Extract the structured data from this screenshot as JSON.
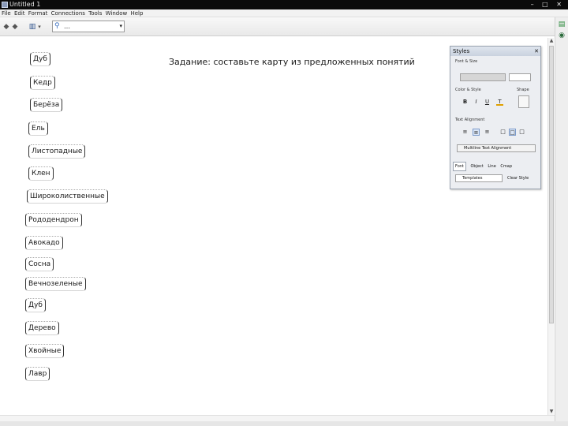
{
  "window": {
    "title": "Untitled 1",
    "controls": "– □ ✕"
  },
  "menu": [
    "File",
    "Edit",
    "Format",
    "Connections",
    "Tools",
    "Window",
    "Help"
  ],
  "toolbar": {
    "back_icon": "◆",
    "forward_icon": "◆",
    "page_icon": "▥",
    "page_dropdown": "▾",
    "zoom_value": "…",
    "zoom_arrow": "▾"
  },
  "canvas": {
    "task": "Задание: составьте карту из предложенных понятий",
    "concepts": [
      "Дуб",
      "Кедр",
      "Берёза",
      "Ель",
      "Листопадные",
      "Клен",
      "Широколиственные",
      "Рододендрон",
      "Авокадо",
      "Сосна",
      "Вечнозеленые",
      "Дуб",
      "Дерево",
      "Хвойные",
      "Лавр"
    ]
  },
  "styles_panel": {
    "title": "Styles",
    "font_label": "Font & Size",
    "color_label": "Color & Style",
    "shape_label": "Shape",
    "bold": "B",
    "italic": "I",
    "underline": "U",
    "font_color": "T",
    "align_label": "Text Alignment",
    "align_left": "≡",
    "align_center": "≡",
    "align_right": "≡",
    "pos1": "□",
    "pos2": "□",
    "pos3": "□",
    "more_label": "Multiline Text Alignment",
    "tabs": [
      "Font",
      "Object",
      "Line",
      "Cmap"
    ],
    "footer_left": "Templates",
    "footer_right": "Clear Style"
  },
  "accent_colors": {
    "title_bar": "#0b0b0b",
    "panel_header": "#c9d2df",
    "link_icon": "#3a6fc0"
  }
}
